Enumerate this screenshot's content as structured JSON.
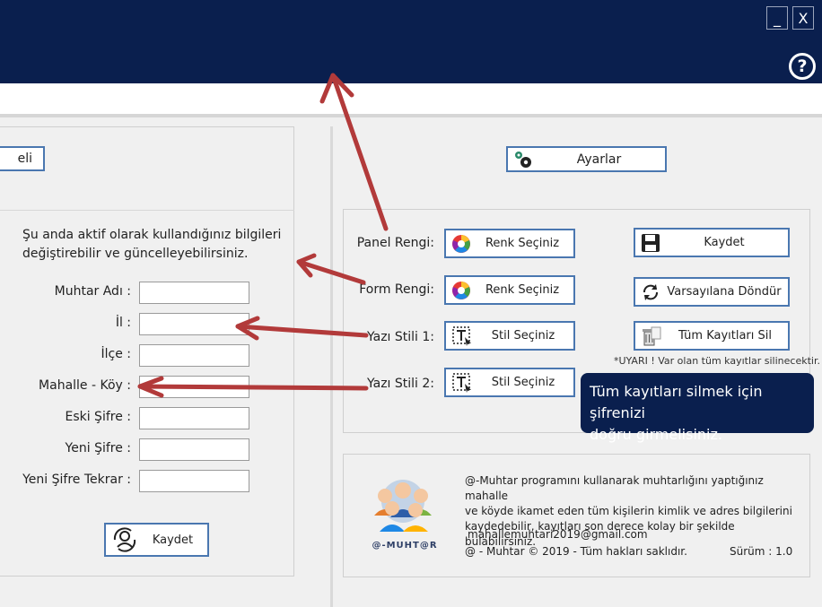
{
  "window": {
    "minimize_label": "_",
    "close_label": "X",
    "help_label": "?"
  },
  "left": {
    "top_button_label": "eli",
    "info_text_line1": "Şu anda aktif olarak kullandığınız bilgileri",
    "info_text_line2": "değiştirebilir ve güncelleyebilirsiniz.",
    "fields": [
      {
        "label": "Muhtar Adı :",
        "value": ""
      },
      {
        "label": "İl :",
        "value": ""
      },
      {
        "label": "İlçe :",
        "value": ""
      },
      {
        "label": "Mahalle - Köy :",
        "value": ""
      },
      {
        "label": "Eski Şifre :",
        "value": ""
      },
      {
        "label": "Yeni Şifre :",
        "value": ""
      },
      {
        "label": "Yeni Şifre Tekrar :",
        "value": ""
      }
    ],
    "save_label": "Kaydet"
  },
  "right": {
    "settings_label": "Ayarlar",
    "rows": [
      {
        "label": "Panel Rengi:",
        "button": "Renk Seçiniz"
      },
      {
        "label": "Form Rengi:",
        "button": "Renk Seçiniz"
      },
      {
        "label": "Yazı Stili 1:",
        "button": "Stil Seçiniz"
      },
      {
        "label": "Yazı Stili 2:",
        "button": "Stil Seçiniz"
      }
    ],
    "save_label": "Kaydet",
    "reset_label": "Varsayılana Döndür",
    "delete_all_label": "Tüm Kayıtları Sil",
    "warning": "*UYARI ! Var olan tüm kayıtlar silinecektir.",
    "tooltip_line1": "Tüm kayıtları silmek için şifrenizi",
    "tooltip_line2": "doğru girmelisiniz."
  },
  "about": {
    "line1": "@-Muhtar programını kullanarak muhtarlığını yaptığınız mahalle",
    "line2": "ve köyde ikamet eden tüm kişilerin kimlik ve adres bilgilerini",
    "line3": "kaydedebilir, kayıtları son derece kolay bir şekilde bulabilirsiniz.",
    "email": "mahallemuhtari2019@gmail.com",
    "copyright": "@ - Muhtar © 2019 - Tüm hakları saklıdır.",
    "version": "Sürüm : 1.0",
    "logo_text": "@-MUHT@R"
  },
  "colors": {
    "titlebar": "#0a1f4e",
    "button_border": "#4a77b0",
    "annotation_arrow": "#b23a3a"
  }
}
